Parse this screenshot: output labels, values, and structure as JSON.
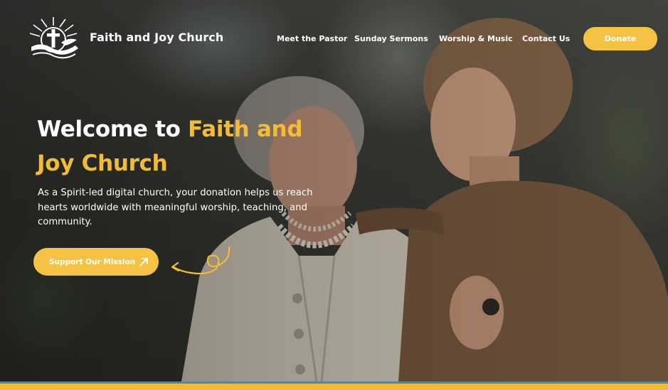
{
  "header": {
    "brand_name": "Faith and Joy Church",
    "logo_icon": "cross-dove-logo-icon",
    "nav": [
      {
        "label": "Meet the Pastor"
      },
      {
        "label": "Sunday Sermons"
      },
      {
        "label": "Worship & Music"
      },
      {
        "label": "Contact Us"
      }
    ],
    "donate_label": "Donate"
  },
  "hero": {
    "headline_white": "Welcome to ",
    "headline_accent_1": "Faith and",
    "headline_accent_2": "Joy Church",
    "subtext": "As a Spirit-led digital church, your donation helps us reach hearts worldwide with meaningful worship, teaching, and community.",
    "cta_label": "Support Our Mission",
    "cta_icon": "arrow-up-right-icon",
    "decor_icon": "curly-arrow-icon",
    "photo_description_icon": "hero-photo"
  },
  "colors": {
    "accent": "#f4bb34",
    "button": "#f6c244",
    "stripe_blue": "#2f8fd6",
    "text": "#ffffff"
  }
}
